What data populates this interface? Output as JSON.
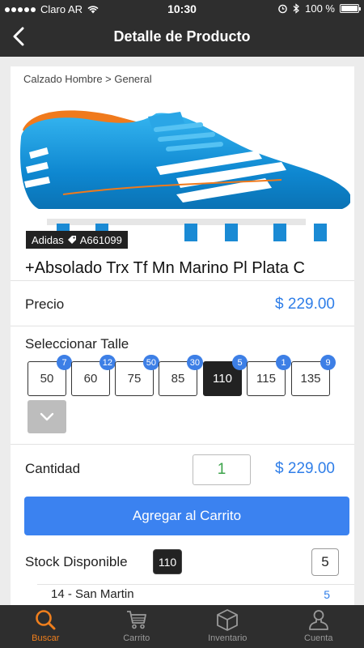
{
  "status": {
    "carrier": "Claro AR",
    "time": "10:30",
    "battery": "100 %"
  },
  "nav": {
    "title": "Detalle de Producto"
  },
  "product": {
    "breadcrumb": "Calzado Hombre > General",
    "brand": "Adidas",
    "code": "A661099",
    "title": "+Absolado Trx Tf Mn Marino Pl Plata C",
    "price_label": "Precio",
    "price": "$ 229.00"
  },
  "sizes": {
    "label": "Seleccionar Talle",
    "selected": "110",
    "options": [
      {
        "size": "50",
        "stock": "7"
      },
      {
        "size": "60",
        "stock": "12"
      },
      {
        "size": "75",
        "stock": "50"
      },
      {
        "size": "85",
        "stock": "30"
      },
      {
        "size": "110",
        "stock": "5"
      },
      {
        "size": "115",
        "stock": "1"
      },
      {
        "size": "135",
        "stock": "9"
      }
    ]
  },
  "quantity": {
    "label": "Cantidad",
    "value": "1",
    "total": "$ 229.00"
  },
  "cart": {
    "add_label": "Agregar al Carrito"
  },
  "stock": {
    "label": "Stock Disponible",
    "size": "110",
    "count": "5",
    "branches": [
      {
        "name": "14 - San Martin",
        "count": "5"
      }
    ]
  },
  "tabs": [
    {
      "label": "Buscar",
      "icon": "search-icon",
      "active": true
    },
    {
      "label": "Carrito",
      "icon": "cart-icon",
      "active": false
    },
    {
      "label": "Inventario",
      "icon": "box-icon",
      "active": false
    },
    {
      "label": "Cuenta",
      "icon": "user-icon",
      "active": false
    }
  ],
  "colors": {
    "accent": "#3b82f0",
    "active_tab": "#f07f1d",
    "bar": "#2e2e2e",
    "quantity": "#3ca34a"
  }
}
